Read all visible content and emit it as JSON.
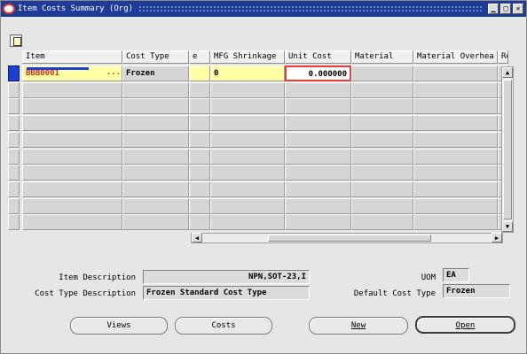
{
  "window": {
    "title": "Item Costs Summary (Org)"
  },
  "toolbar": {
    "icon_name": "folder-edit-icon"
  },
  "table": {
    "columns": [
      "Item",
      "Cost Type",
      "e",
      "MFG Shrinkage",
      "Unit Cost",
      "Material",
      "Material Overhea",
      "Re"
    ],
    "active_row": {
      "item": "BBB0001",
      "lov": "...",
      "cost_type": "Frozen",
      "mfg_shrinkage": "0",
      "unit_cost": "0.000000"
    }
  },
  "fields": {
    "item_description_label": "Item Description",
    "item_description": "NPN,SOT-23,I",
    "cost_type_description_label": "Cost Type Description",
    "cost_type_description": "Frozen Standard Cost Type",
    "uom_label": "UOM",
    "uom": "EA",
    "default_cost_type_label": "Default Cost Type",
    "default_cost_type": "Frozen"
  },
  "buttons": {
    "views": "Views",
    "costs": "Costs",
    "new": "New",
    "open": "Open"
  }
}
